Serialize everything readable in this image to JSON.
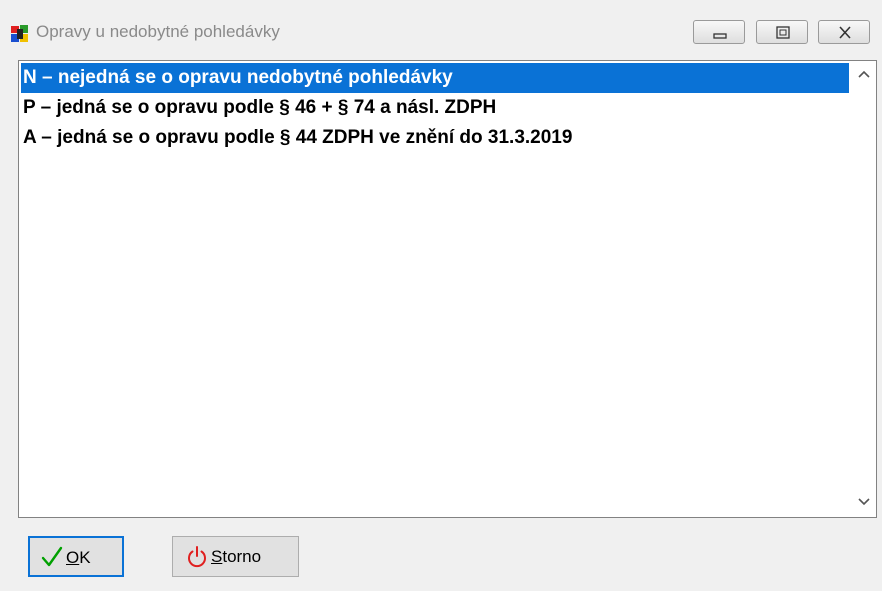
{
  "window": {
    "title": "Opravy u nedobytné pohledávky",
    "controls": [
      "minimize",
      "restore",
      "close"
    ]
  },
  "list": {
    "items": [
      {
        "label": "N – nejedná se o opravu nedobytné pohledávky",
        "selected": true
      },
      {
        "label": "P – jedná se o opravu podle § 46 + § 74 a násl. ZDPH",
        "selected": false
      },
      {
        "label": "A – jedná se o opravu podle § 44 ZDPH ve znění do 31.3.2019",
        "selected": false
      }
    ],
    "selection_color": "#0a72d6"
  },
  "buttons": {
    "ok": {
      "label_first": "O",
      "label_rest": "K",
      "icon": "checkmark-icon",
      "color": "#00a000"
    },
    "storno": {
      "label_first": "S",
      "label_rest": "torno",
      "icon": "power-icon",
      "color": "#e02020"
    }
  }
}
